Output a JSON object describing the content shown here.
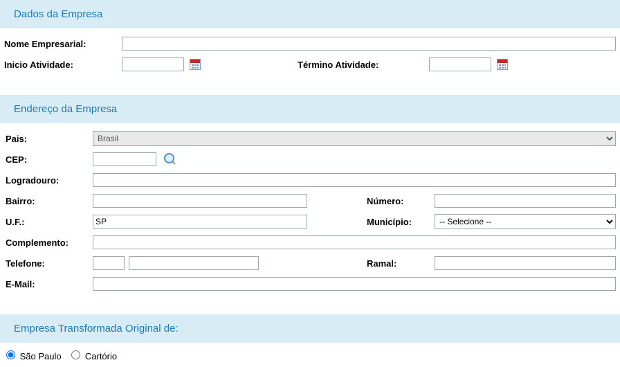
{
  "section1": {
    "title": "Dados da Empresa"
  },
  "nome": {
    "label": "Nome Empresarial:",
    "value": ""
  },
  "inicio": {
    "label": "Inicio Atividade:",
    "value": ""
  },
  "termino": {
    "label": "Término Atividade:",
    "value": ""
  },
  "section2": {
    "title": "Endereço da Empresa"
  },
  "pais": {
    "label": "Pais:",
    "value": "Brasil"
  },
  "cep": {
    "label": "CEP:",
    "value": ""
  },
  "logradouro": {
    "label": "Logradouro:",
    "value": ""
  },
  "bairro": {
    "label": "Bairro:",
    "value": ""
  },
  "numero": {
    "label": "Número:",
    "value": ""
  },
  "uf": {
    "label": "U.F.:",
    "value": "SP"
  },
  "municipio": {
    "label": "Município:",
    "value": "-- Selecione --"
  },
  "complemento": {
    "label": "Complemento:",
    "value": ""
  },
  "telefone": {
    "label": "Telefone:",
    "ddd": "",
    "numero": ""
  },
  "ramal": {
    "label": "Ramal:",
    "value": ""
  },
  "email": {
    "label": "E-Mail:",
    "value": ""
  },
  "section3": {
    "title": "Empresa Transformada Original de:"
  },
  "origem": {
    "option1": "São Paulo",
    "option2": "Cartório",
    "selected": "São Paulo"
  }
}
